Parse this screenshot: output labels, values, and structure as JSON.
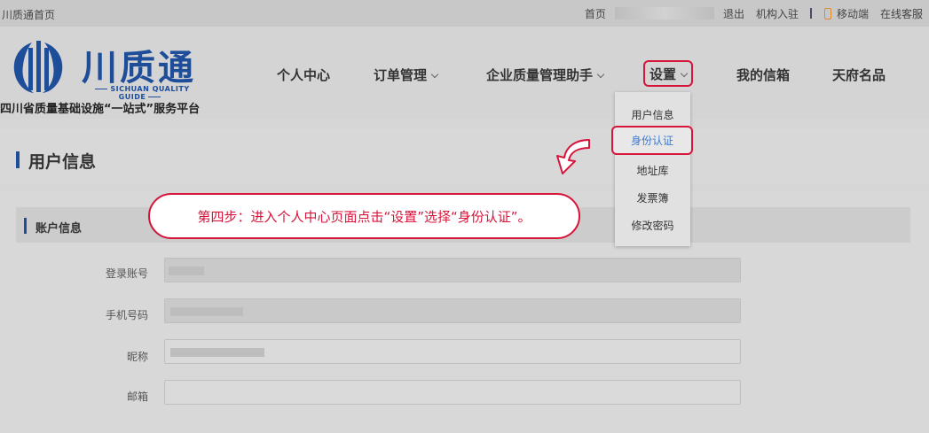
{
  "topbar": {
    "site_home": "川质通首页",
    "home": "首页",
    "logout": "退出",
    "org_register": "机构入驻",
    "mobile": "移动端",
    "online_service": "在线客服"
  },
  "logo": {
    "title": "川质通",
    "english": "SICHUAN QUALITY GUIDE",
    "slogan": "四川省质量基础设施“一站式”服务平台"
  },
  "nav": {
    "personal_center": "个人中心",
    "order_management": "订单管理",
    "quality_assistant": "企业质量管理助手",
    "settings": "设置",
    "my_mailbox": "我的信箱",
    "tianfu_brands": "天府名品"
  },
  "dropdown": {
    "user_info": "用户信息",
    "identity_auth": "身份认证",
    "address_book": "地址库",
    "invoice_book": "发票簿",
    "change_password": "修改密码"
  },
  "page": {
    "title": "用户信息",
    "section_title": "账户信息"
  },
  "form": {
    "login_account": "登录账号",
    "phone_number": "手机号码",
    "nickname": "昵称",
    "email": "邮箱"
  },
  "callout": {
    "text": "第四步：进入个人中心页面点击“设置”选择“身份认证”。"
  },
  "colors": {
    "brand_blue": "#1e4d9a",
    "highlight_red": "#d7143a",
    "link_blue": "#3a7bd5"
  }
}
